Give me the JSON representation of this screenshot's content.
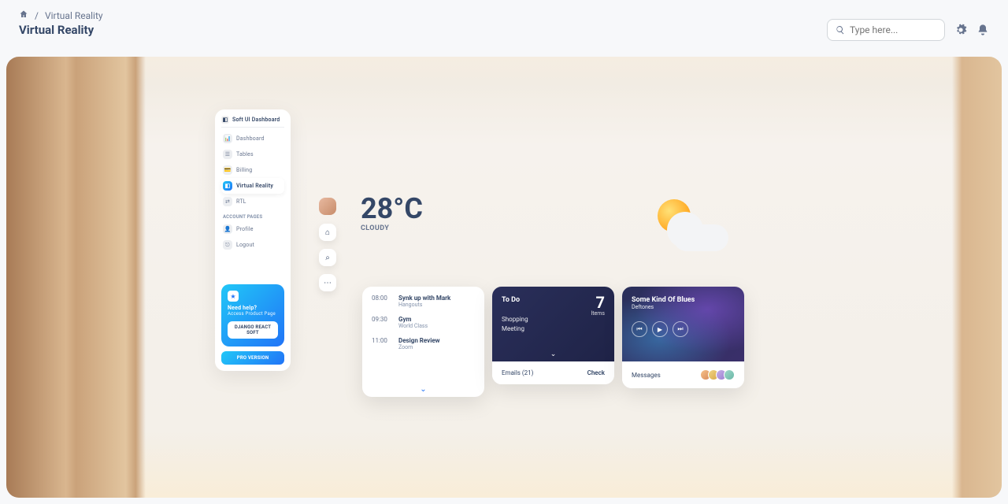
{
  "breadcrumb": {
    "home": "Home",
    "sep": "/",
    "current": "Virtual Reality"
  },
  "page_title": "Virtual Reality",
  "search": {
    "placeholder": "Type here..."
  },
  "sidenav": {
    "brand": "Soft UI Dashboard",
    "items": [
      {
        "label": "Dashboard",
        "icon": "📊"
      },
      {
        "label": "Tables",
        "icon": "☰"
      },
      {
        "label": "Billing",
        "icon": "💳"
      },
      {
        "label": "Virtual Reality",
        "icon": "◧",
        "active": true
      },
      {
        "label": "RTL",
        "icon": "⇄"
      }
    ],
    "section_label": "ACCOUNT PAGES",
    "account_items": [
      {
        "label": "Profile",
        "icon": "👤"
      },
      {
        "label": "Logout",
        "icon": "⎋"
      }
    ],
    "help": {
      "title": "Need help?",
      "subtitle": "Access Product Page",
      "button": "DJANGO REACT SOFT"
    },
    "pro_button": "PRO VERSION"
  },
  "weather": {
    "temp": "28°C",
    "condition": "CLOUDY"
  },
  "schedule": {
    "rows": [
      {
        "time": "08:00",
        "title": "Synk up with Mark",
        "sub": "Hangouts"
      },
      {
        "time": "09:30",
        "title": "Gym",
        "sub": "World Class"
      },
      {
        "time": "11:00",
        "title": "Design Review",
        "sub": "Zoom"
      }
    ]
  },
  "todo": {
    "title": "To Do",
    "count": "7",
    "count_label": "Items",
    "list": [
      "Shopping",
      "Meeting"
    ],
    "emails_label": "Emails (21)",
    "check_label": "Check"
  },
  "music": {
    "title": "Some Kind Of Blues",
    "artist": "Deftones",
    "messages_label": "Messages"
  }
}
